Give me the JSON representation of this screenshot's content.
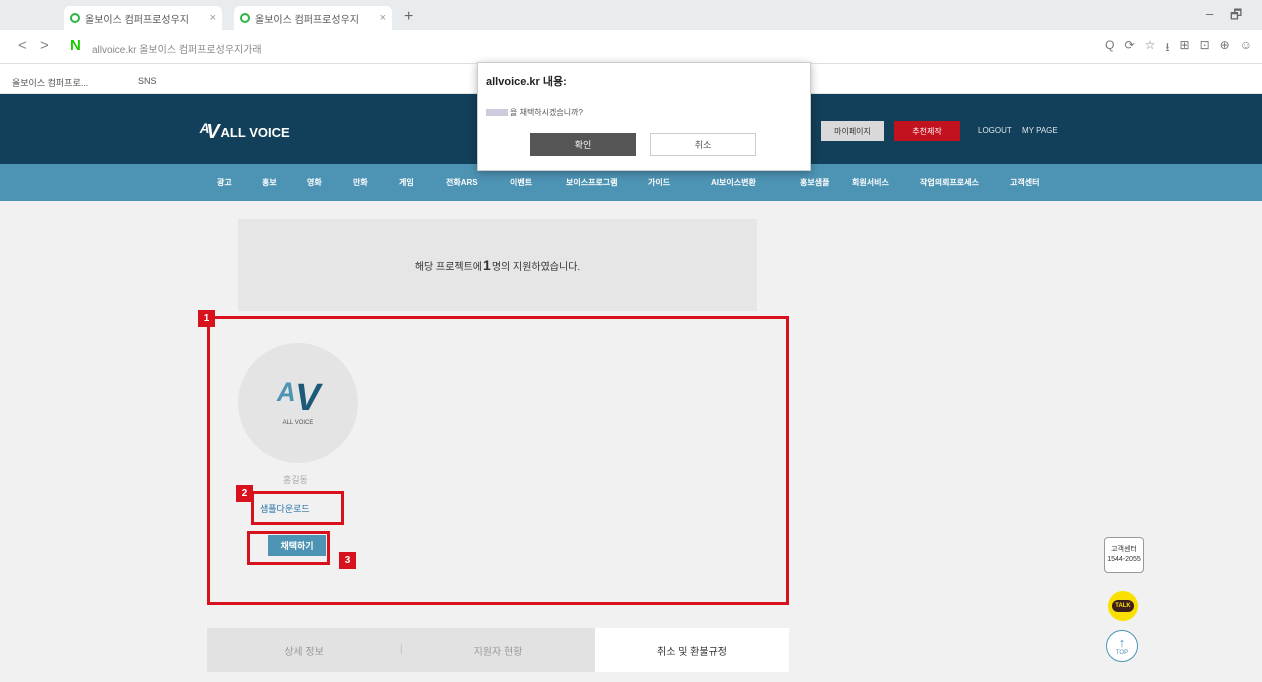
{
  "browser": {
    "tabs": [
      {
        "label": "올보이스 컴퍼프로성우지"
      },
      {
        "label": "올보이스 컴퍼프로성우지"
      }
    ],
    "new_tab": "+",
    "window_controls": [
      "–",
      "🗗"
    ],
    "nav": {
      "back": "<",
      "forward": ">"
    },
    "url": "allvoice.kr 올보이스 컴퍼프로성우지가래",
    "bookmarks": [
      {
        "label": "올보이스 컴퍼프로..."
      },
      {
        "label": "SNS"
      }
    ],
    "toolbar_icons": [
      "Q",
      "⟳",
      "☆",
      "⭳",
      "⊞",
      "⊡",
      "⊕",
      "☺"
    ]
  },
  "site": {
    "logo_text": "ALL VOICE",
    "header_buttons": {
      "gray": "마이페이지",
      "red": "추천제작"
    },
    "header_links": [
      "LOGOUT",
      "MY PAGE"
    ],
    "menu": [
      "광고",
      "홍보",
      "영화",
      "만화",
      "게임",
      "전화ARS",
      "이벤트",
      "보이스프로그램",
      "가이드",
      "AI보이스변환",
      "홍보샘플",
      "회원서비스",
      "작업의뢰프로세스",
      "고객센터"
    ]
  },
  "content": {
    "notice_pre": "해당 프로젝트에",
    "notice_count": "1",
    "notice_post": "명의 지원하였습니다.",
    "avatar_logo": "ALL VOICE",
    "applicant_name": "홍길동",
    "sample_download": "샘플다운로드",
    "select_button": "채택하기",
    "tabs": [
      {
        "label": "상세 정보"
      },
      {
        "label": "지원자 현황"
      },
      {
        "label": "취소 및 환불규정"
      }
    ],
    "tab_separator": "|"
  },
  "annotations": [
    {
      "label": "1"
    },
    {
      "label": "2"
    },
    {
      "label": "3"
    }
  ],
  "floating": {
    "cs_label": "고객센터",
    "cs_phone": "1544-2055",
    "talk": "TALK",
    "top": "TOP"
  },
  "dialog": {
    "title": "allvoice.kr 내용:",
    "message": "을 채택하시겠습니까?",
    "ok": "확인",
    "cancel": "취소"
  }
}
